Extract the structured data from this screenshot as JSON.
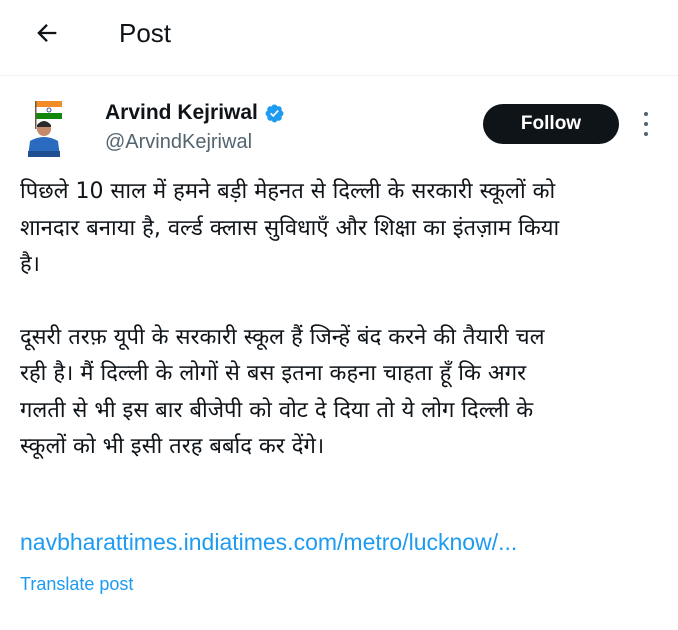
{
  "header": {
    "title": "Post",
    "back_icon": "arrow-left-icon"
  },
  "post": {
    "author": {
      "name": "Arvind Kejriwal",
      "handle": "@ArvindKejriwal",
      "verified_icon": "verified-badge-icon",
      "verified_color": "#1d9bf0"
    },
    "follow_label": "Follow",
    "more_icon": "more-vertical-icon",
    "paragraphs": [
      "पिछले 10 साल में हमने बड़ी मेहनत से दिल्ली के सरकारी स्कूलों को\nशानदार बनाया है, वर्ल्ड क्लास सुविधाएँ और शिक्षा का इंतज़ाम किया\nहै।",
      "दूसरी तरफ़ यूपी के सरकारी स्कूल हैं जिन्हें बंद करने की तैयारी चल\nरही है। मैं दिल्ली के लोगों से बस इतना कहना चाहता हूँ कि अगर\nगलती से भी इस बार बीजेपी को वोट दे दिया तो ये लोग दिल्ली के\nस्कूलों को भी इसी तरह बर्बाद कर देंगे।"
    ],
    "link_text": "navbharattimes.indiatimes.com/metro/lucknow/...",
    "translate_label": "Translate post"
  },
  "colors": {
    "accent": "#1d9bf0",
    "text": "#0f1419",
    "secondary": "#536471",
    "button_bg": "#0f1419"
  }
}
